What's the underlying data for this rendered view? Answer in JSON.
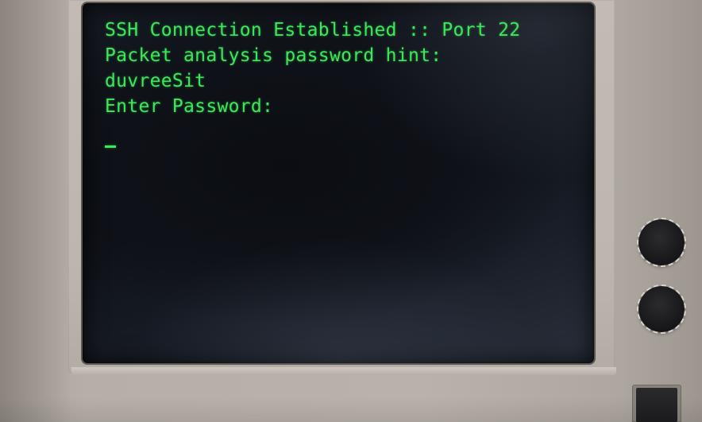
{
  "terminal": {
    "lines": [
      "SSH Connection Established :: Port 22",
      "Packet analysis password hint:",
      "duvreeSit",
      "Enter Password:"
    ],
    "input_value": "",
    "cursor_glyph": "_"
  },
  "colors": {
    "terminal_text": "#3ee65a",
    "screen_bg": "#0e1117",
    "casing": "#b9b2ab",
    "knob": "#19191b"
  },
  "icons": {
    "knob_top": "dial-knob-icon",
    "knob_bottom": "dial-knob-icon",
    "power": "power-button-icon"
  }
}
